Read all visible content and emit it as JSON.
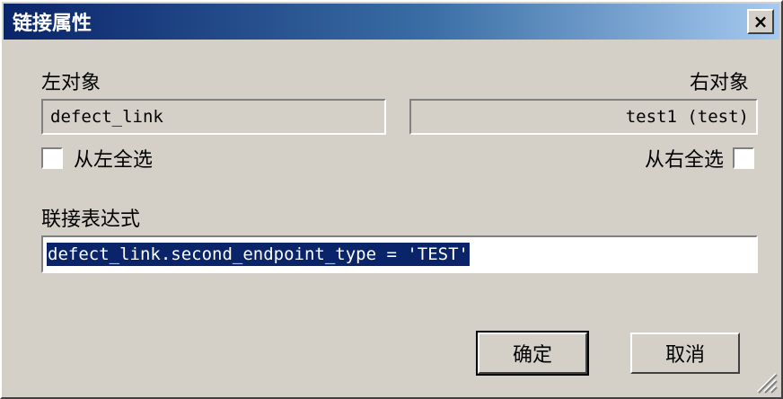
{
  "dialog": {
    "title": "链接属性",
    "close_label": "×"
  },
  "left_object": {
    "label": "左对象",
    "value": "defect_link"
  },
  "right_object": {
    "label": "右对象",
    "value": "test1 (test)"
  },
  "select_left": {
    "label": "从左全选",
    "checked": false
  },
  "select_right": {
    "label": "从右全选",
    "checked": false
  },
  "expression": {
    "label": "联接表达式",
    "value": "defect_link.second_endpoint_type = 'TEST'"
  },
  "buttons": {
    "ok_label": "确定",
    "cancel_label": "取消"
  }
}
